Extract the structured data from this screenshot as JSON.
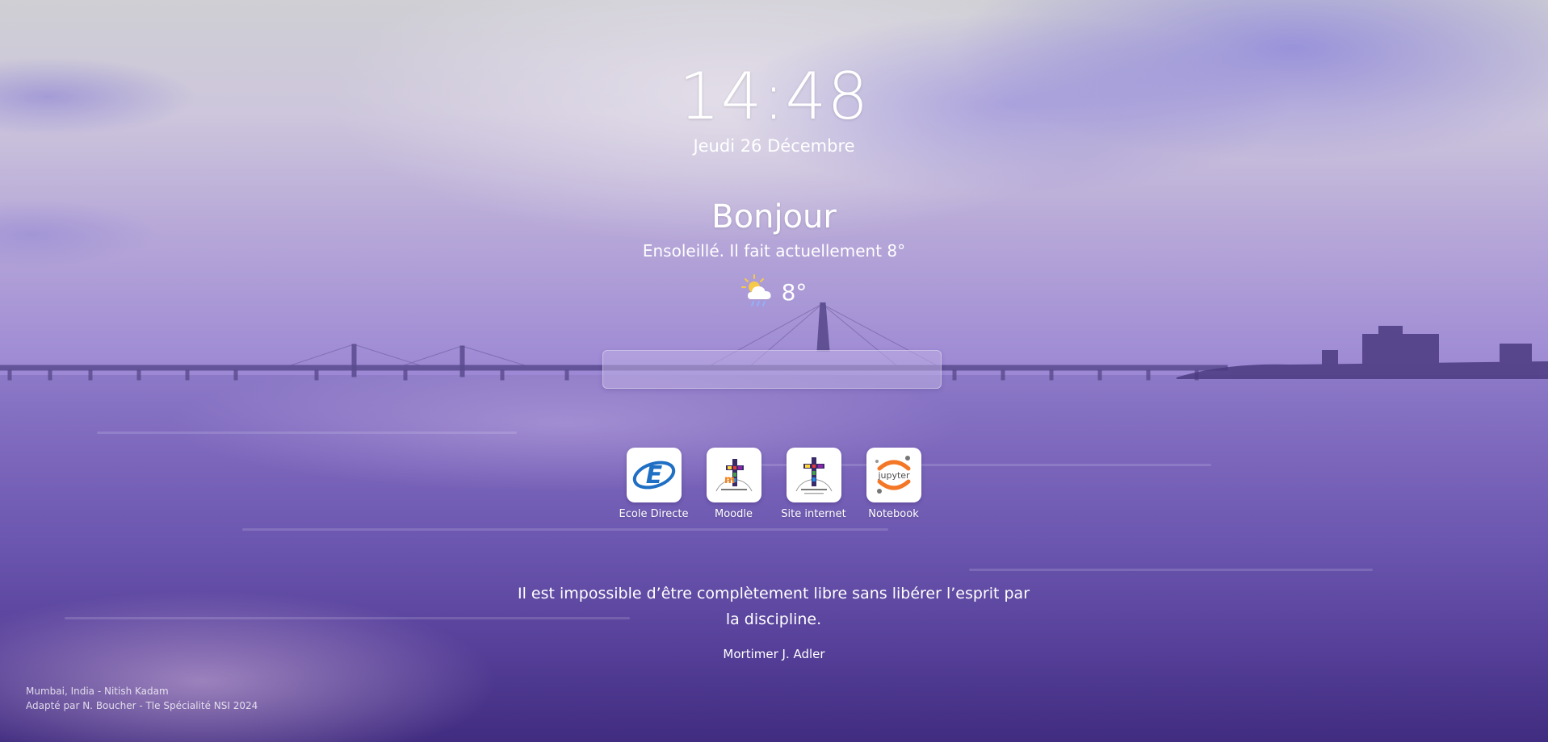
{
  "clock": {
    "time": "14:48",
    "date": "Jeudi 26 Décembre"
  },
  "greeting": "Bonjour",
  "weather": {
    "description": "Ensoleillé. Il fait actuellement 8°",
    "temperature": "8°",
    "icon": "sun-cloud-rain-icon"
  },
  "search": {
    "placeholder": ""
  },
  "shortcuts": [
    {
      "label": "Ecole Directe",
      "icon": "ecole-directe-logo"
    },
    {
      "label": "Moodle",
      "icon": "moodle-logo"
    },
    {
      "label": "Site internet",
      "icon": "sainte-celine-logo"
    },
    {
      "label": "Notebook",
      "icon": "jupyter-logo"
    }
  ],
  "quote": {
    "text": "Il est impossible d’être complètement libre sans libérer l’esprit par la discipline.",
    "author": "Mortimer J. Adler"
  },
  "credits": {
    "photo": "Mumbai, India - Nitish Kadam",
    "adapted": "Adapté par N. Boucher - Tle Spécialité NSI 2024"
  },
  "colors": {
    "accent": "#ffffff",
    "ecole_blue": "#1f6fc4",
    "jupyter_orange": "#f37726",
    "sky": "#cfcfd4",
    "water": "#6c57b0"
  }
}
